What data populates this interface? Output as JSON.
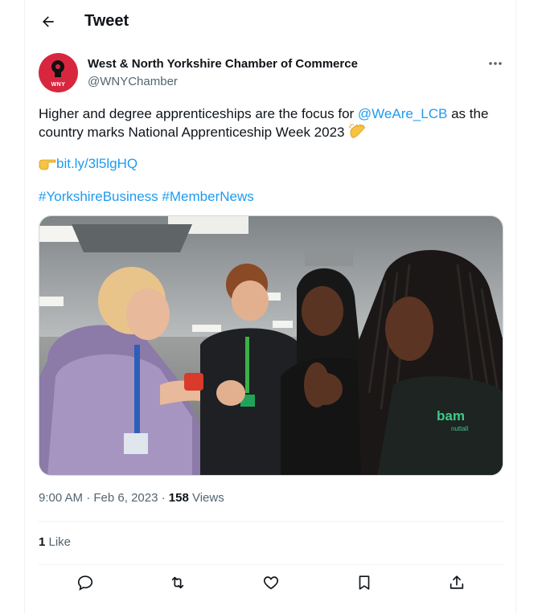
{
  "header": {
    "title": "Tweet",
    "back_icon": "arrow-left-icon"
  },
  "author": {
    "name": "West & North Yorkshire Chamber of Commerce",
    "handle": "@WNYChamber",
    "avatar_text": "WNY",
    "avatar_color": "#d9263f"
  },
  "tweet": {
    "text_before": "Higher and degree apprenticeships are the focus for ",
    "mention": "@WeAre_LCB",
    "text_after": " as the country marks National Apprenticeship Week 2023",
    "link": "bit.ly/3l5lgHQ",
    "hashtag1": "#YorkshireBusiness",
    "hashtag2": "#MemberNews",
    "image_tshirt_text": "bam",
    "image_tshirt_subtext": "nuttall"
  },
  "meta": {
    "time": "9:00 AM",
    "sep1": " · ",
    "date": "Feb 6, 2023",
    "sep2": " · ",
    "views_count": "158",
    "views_label": " Views"
  },
  "likes": {
    "count": "1",
    "label": " Like"
  },
  "colors": {
    "accent": "#1d9bf0",
    "secondary_text": "#536471"
  }
}
